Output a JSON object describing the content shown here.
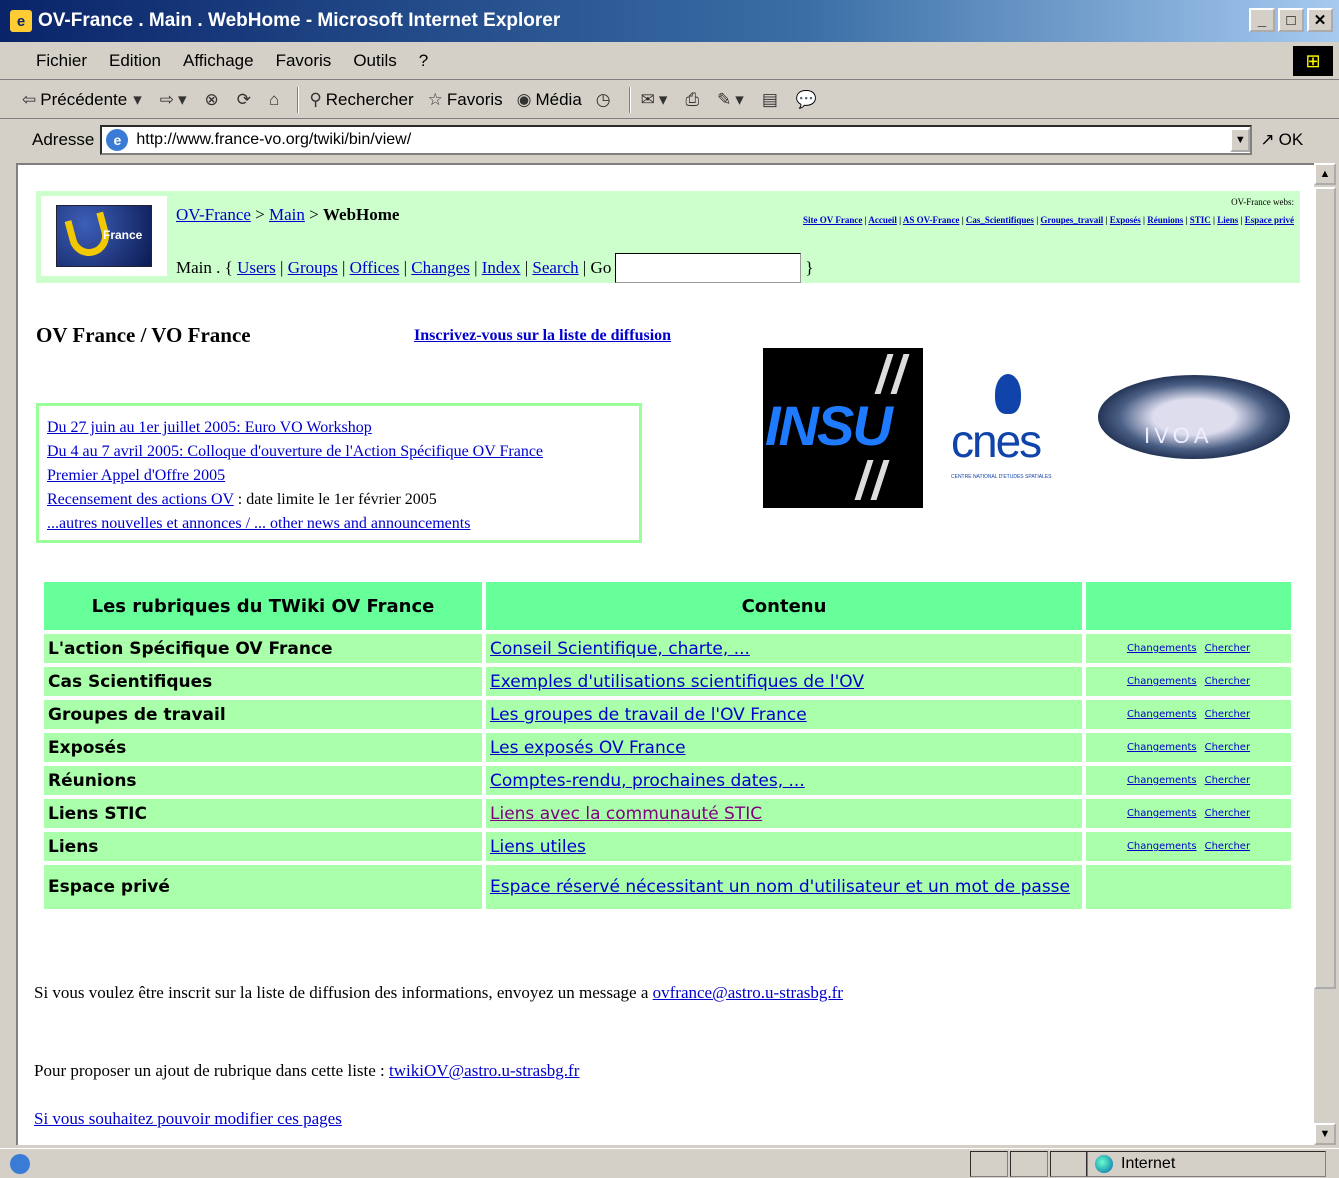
{
  "window": {
    "title": "OV-France . Main . WebHome - Microsoft Internet Explorer"
  },
  "menu": [
    "Fichier",
    "Edition",
    "Affichage",
    "Favoris",
    "Outils",
    "?"
  ],
  "toolbar": {
    "back": "Précédente",
    "search": "Rechercher",
    "favorites": "Favoris",
    "media": "Média"
  },
  "address": {
    "label": "Adresse",
    "url": "http://www.france-vo.org/twiki/bin/view/",
    "go": "OK"
  },
  "twiki": {
    "crumb_root": "OV-France",
    "crumb_web": "Main",
    "crumb_page": "WebHome",
    "web_name": "Main",
    "web_links": [
      "Users",
      "Groups",
      "Offices",
      "Changes",
      "Index",
      "Search"
    ],
    "go_label": "Go",
    "webs_title": "OV-France webs:",
    "webs": [
      "Site OV France",
      "Accueil",
      "AS OV-France",
      "Cas_Scientifiques",
      "Groupes_travail",
      "Exposés",
      "Réunions",
      "STIC",
      "Liens",
      "Espace privé"
    ]
  },
  "page": {
    "title": "OV France / VO France",
    "subscribe": "Inscrivez-vous sur la liste de diffusion",
    "news": [
      {
        "link": "Du 27 juin au 1er juillet 2005: Euro VO Workshop",
        "text": ""
      },
      {
        "link": "Du 4 au 7 avril 2005: Colloque d'ouverture de l'Action Spécifique OV France",
        "text": ""
      },
      {
        "link": "Premier Appel d'Offre 2005",
        "text": ""
      },
      {
        "link": "Recensement des actions OV",
        "text": " : date limite le 1er février 2005"
      },
      {
        "link": "...autres nouvelles et annonces / ... other news and announcements",
        "text": ""
      }
    ],
    "logos": {
      "insu": "INSU",
      "cnes": "cnes",
      "cnes_small": "CENTRE NATIONAL D'ETUDES SPATIALES",
      "ivoa": "IVOA"
    }
  },
  "table": {
    "headers": [
      "Les rubriques du TWiki OV France",
      "Contenu",
      ""
    ],
    "action_changes": "Changements",
    "action_search": "Chercher",
    "rows": [
      {
        "name": "L'action Spécifique OV France",
        "content": "Conseil Scientifique, charte, ..."
      },
      {
        "name": "Cas Scientifiques",
        "content": "Exemples d'utilisations scientifiques de l'OV"
      },
      {
        "name": "Groupes de travail",
        "content": "Les groupes de travail de l'OV France"
      },
      {
        "name": "Exposés",
        "content": "Les exposés OV France"
      },
      {
        "name": "Réunions",
        "content": "Comptes-rendu, prochaines dates, ..."
      },
      {
        "name": "Liens STIC",
        "content": "Liens avec la communauté STIC"
      },
      {
        "name": "Liens",
        "content": "Liens utiles"
      },
      {
        "name": "Espace privé",
        "content": "Espace réservé nécessitant un nom d'utilisateur et un mot de passe"
      }
    ]
  },
  "footer": {
    "line1_text": "Si vous voulez être inscrit sur la liste de diffusion des informations, envoyez un message a ",
    "line1_link": "ovfrance@astro.u-strasbg.fr",
    "line2_text": "Pour proposer un ajout de rubrique dans cette liste : ",
    "line2_link": "twikiOV@astro.u-strasbg.fr",
    "line3_link": "Si vous souhaitez pouvoir modifier ces pages"
  },
  "status": {
    "zone": "Internet"
  }
}
